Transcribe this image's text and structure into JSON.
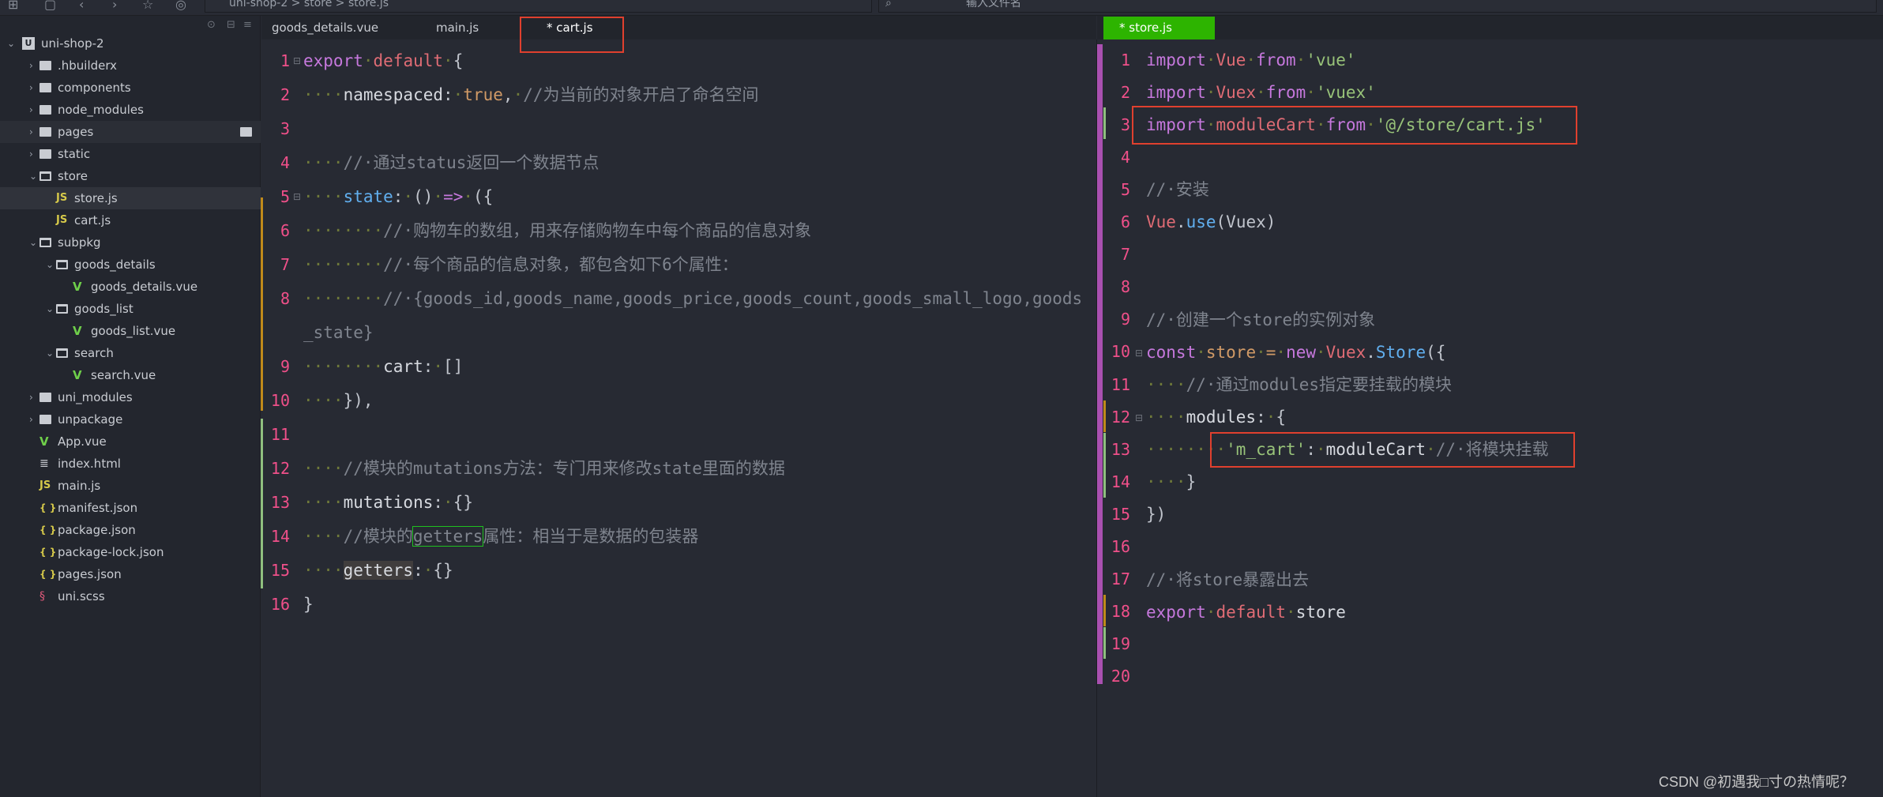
{
  "toolbar": {
    "icons": [
      "new-file-icon",
      "save-icon",
      "back-icon",
      "forward-icon",
      "star-icon",
      "run-icon"
    ]
  },
  "breadcrumb": {
    "items": [
      "uni-shop-2",
      "store",
      "store.js"
    ],
    "separator": ">"
  },
  "search": {
    "placeholder": "输入文件名"
  },
  "sidebar": {
    "tree": [
      {
        "label": "uni-shop-2",
        "depth": 0,
        "kind": "project",
        "expanded": true
      },
      {
        "label": ".hbuilderx",
        "depth": 1,
        "kind": "folder"
      },
      {
        "label": "components",
        "depth": 1,
        "kind": "folder"
      },
      {
        "label": "node_modules",
        "depth": 1,
        "kind": "folder"
      },
      {
        "label": "pages",
        "depth": 1,
        "kind": "folder",
        "hover": true
      },
      {
        "label": "static",
        "depth": 1,
        "kind": "folder"
      },
      {
        "label": "store",
        "depth": 1,
        "kind": "folder",
        "expanded": true
      },
      {
        "label": "store.js",
        "depth": 2,
        "kind": "js",
        "selected": true
      },
      {
        "label": "cart.js",
        "depth": 2,
        "kind": "js"
      },
      {
        "label": "subpkg",
        "depth": 1,
        "kind": "folder",
        "expanded": true
      },
      {
        "label": "goods_details",
        "depth": 2,
        "kind": "folder",
        "expanded": true
      },
      {
        "label": "goods_details.vue",
        "depth": 3,
        "kind": "vue"
      },
      {
        "label": "goods_list",
        "depth": 2,
        "kind": "folder",
        "expanded": true
      },
      {
        "label": "goods_list.vue",
        "depth": 3,
        "kind": "vue"
      },
      {
        "label": "search",
        "depth": 2,
        "kind": "folder",
        "expanded": true
      },
      {
        "label": "search.vue",
        "depth": 3,
        "kind": "vue"
      },
      {
        "label": "uni_modules",
        "depth": 1,
        "kind": "folder"
      },
      {
        "label": "unpackage",
        "depth": 1,
        "kind": "folder"
      },
      {
        "label": "App.vue",
        "depth": 1,
        "kind": "vue"
      },
      {
        "label": "index.html",
        "depth": 1,
        "kind": "html"
      },
      {
        "label": "main.js",
        "depth": 1,
        "kind": "js"
      },
      {
        "label": "manifest.json",
        "depth": 1,
        "kind": "json"
      },
      {
        "label": "package.json",
        "depth": 1,
        "kind": "json"
      },
      {
        "label": "package-lock.json",
        "depth": 1,
        "kind": "json"
      },
      {
        "label": "pages.json",
        "depth": 1,
        "kind": "json"
      },
      {
        "label": "uni.scss",
        "depth": 1,
        "kind": "scss"
      }
    ]
  },
  "left_editor": {
    "tabs": [
      {
        "label": "goods_details.vue"
      },
      {
        "label": "main.js"
      },
      {
        "label": "* cart.js",
        "active": true
      }
    ],
    "lines": [
      [
        [
          "export",
          "kw"
        ],
        [
          "·",
          "ws"
        ],
        [
          "default",
          "df"
        ],
        [
          "·",
          "ws"
        ],
        [
          "{",
          "pn"
        ]
      ],
      [
        [
          "····",
          "ws"
        ],
        [
          "namespaced",
          "pl"
        ],
        [
          ":",
          "pn"
        ],
        [
          "·",
          "ws"
        ],
        [
          "true",
          "bo"
        ],
        [
          ",",
          "pn"
        ],
        [
          "·",
          "ws"
        ],
        [
          "//为当前的对象开启了命名空间",
          "cm"
        ]
      ],
      [],
      [
        [
          "····",
          "ws"
        ],
        [
          "//·通过status返回一个数据节点",
          "cm"
        ]
      ],
      [
        [
          "····",
          "ws"
        ],
        [
          "state",
          "fn"
        ],
        [
          ":",
          "pn"
        ],
        [
          "·",
          "ws"
        ],
        [
          "()",
          "pn"
        ],
        [
          "·",
          "ws"
        ],
        [
          "=>",
          "kw"
        ],
        [
          "·",
          "ws"
        ],
        [
          "({",
          "pn"
        ]
      ],
      [
        [
          "········",
          "ws"
        ],
        [
          "//·购物车的数组，用来存储购物车中每个商品的信息对象",
          "cm"
        ]
      ],
      [
        [
          "········",
          "ws"
        ],
        [
          "//·每个商品的信息对象，都包含如下6个属性：",
          "cm"
        ]
      ],
      [
        [
          "········",
          "ws"
        ],
        [
          "//·{goods_id,goods_name,goods_price,goods_count,goods_small_logo,goods_state}",
          "cm"
        ]
      ],
      [
        [
          "········",
          "ws"
        ],
        [
          "cart",
          "pl"
        ],
        [
          ":",
          "pn"
        ],
        [
          "·",
          "ws"
        ],
        [
          "[]",
          "pn"
        ]
      ],
      [
        [
          "····",
          "ws"
        ],
        [
          "}),",
          "pn"
        ]
      ],
      [],
      [
        [
          "····",
          "ws"
        ],
        [
          "//模块的mutations方法：专门用来修改state里面的数据",
          "cm"
        ]
      ],
      [
        [
          "····",
          "ws"
        ],
        [
          "mutations",
          "pl"
        ],
        [
          ":",
          "pn"
        ],
        [
          "·",
          "ws"
        ],
        [
          "{}",
          "pn"
        ]
      ],
      [
        [
          "····",
          "ws"
        ],
        [
          "//模块的",
          "cm"
        ],
        [
          "getters",
          "cm boxed"
        ],
        [
          "属性：相当于是数据的包装器",
          "cm"
        ]
      ],
      [
        [
          "····",
          "ws"
        ],
        [
          "getters",
          "pl hl"
        ],
        [
          ":",
          "pn"
        ],
        [
          "·",
          "ws"
        ],
        [
          "{}",
          "pn"
        ]
      ],
      [
        [
          "}",
          "pn"
        ]
      ]
    ]
  },
  "right_editor": {
    "tabs": [
      {
        "label": "* store.js",
        "active": true
      }
    ],
    "active_tab_color": "#2db400",
    "lines": [
      [
        [
          "import",
          "kw"
        ],
        [
          "·",
          "ws"
        ],
        [
          "Vue",
          "df"
        ],
        [
          "·",
          "ws"
        ],
        [
          "from",
          "kw"
        ],
        [
          "·",
          "ws"
        ],
        [
          "'vue'",
          "st"
        ]
      ],
      [
        [
          "import",
          "kw"
        ],
        [
          "·",
          "ws"
        ],
        [
          "Vuex",
          "df"
        ],
        [
          "·",
          "ws"
        ],
        [
          "from",
          "kw"
        ],
        [
          "·",
          "ws"
        ],
        [
          "'vuex'",
          "st"
        ]
      ],
      [
        [
          "import",
          "kw"
        ],
        [
          "·",
          "ws"
        ],
        [
          "moduleCart",
          "df"
        ],
        [
          "·",
          "ws"
        ],
        [
          "from",
          "kw"
        ],
        [
          "·",
          "ws"
        ],
        [
          "'@/store/cart.js'",
          "st"
        ]
      ],
      [],
      [
        [
          "//·安装",
          "cm"
        ]
      ],
      [
        [
          "Vue",
          "df"
        ],
        [
          ".",
          "pn"
        ],
        [
          "use",
          "fn"
        ],
        [
          "(Vuex)",
          "pn"
        ]
      ],
      [],
      [],
      [
        [
          "//·创建一个store的实例对象",
          "cm"
        ]
      ],
      [
        [
          "const",
          "kw"
        ],
        [
          "·",
          "ws"
        ],
        [
          "store",
          "bo"
        ],
        [
          "·",
          "ws"
        ],
        [
          "=",
          "bo"
        ],
        [
          "·",
          "ws"
        ],
        [
          "new",
          "kw"
        ],
        [
          "·",
          "ws"
        ],
        [
          "Vuex",
          "df"
        ],
        [
          ".",
          "pn"
        ],
        [
          "Store",
          "fn"
        ],
        [
          "({",
          "pn"
        ]
      ],
      [
        [
          "····",
          "ws"
        ],
        [
          "//·通过modules指定要挂载的模块",
          "cm"
        ]
      ],
      [
        [
          "····",
          "ws"
        ],
        [
          "modules",
          "pl"
        ],
        [
          ":",
          "pn"
        ],
        [
          "·",
          "ws"
        ],
        [
          "{",
          "pn"
        ]
      ],
      [
        [
          "········",
          "ws"
        ],
        [
          "'m_cart'",
          "st"
        ],
        [
          ":",
          "pn"
        ],
        [
          "·",
          "ws"
        ],
        [
          "moduleCart",
          "pl"
        ],
        [
          "·",
          "ws"
        ],
        [
          "//·将模块挂载",
          "cm"
        ]
      ],
      [
        [
          "····",
          "ws"
        ],
        [
          "}",
          "pn"
        ]
      ],
      [
        [
          "})",
          "pn"
        ]
      ],
      [],
      [
        [
          "//·将store暴露出去",
          "cm"
        ]
      ],
      [
        [
          "export",
          "kw"
        ],
        [
          "·",
          "ws"
        ],
        [
          "default",
          "df"
        ],
        [
          "·",
          "ws"
        ],
        [
          "store",
          "pl"
        ]
      ],
      [],
      []
    ]
  },
  "colors": {
    "line_number": "#f0508a",
    "annotation_box": "#e0402e",
    "keyword": "#c678dd",
    "string": "#98c379",
    "comment": "#7f848e"
  },
  "watermark": "CSDN @初遇我□寸の热情呢？"
}
